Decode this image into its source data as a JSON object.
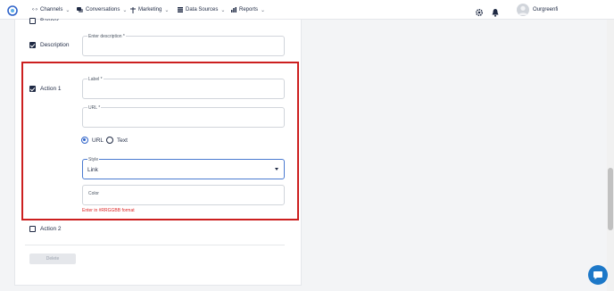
{
  "nav": {
    "items": [
      {
        "label": "Channels"
      },
      {
        "label": "Conversations"
      },
      {
        "label": "Marketing"
      },
      {
        "label": "Data Sources"
      },
      {
        "label": "Reports"
      }
    ],
    "user_name": "Ourgreenfi"
  },
  "form": {
    "banner_label": "Banner",
    "description": {
      "checkbox_label": "Description",
      "field_label": "Enter description *",
      "value": ""
    },
    "action1": {
      "checkbox_label": "Action 1",
      "label_field": {
        "label": "Label *",
        "value": ""
      },
      "url_field": {
        "label": "URL *",
        "value": ""
      },
      "type_options": [
        "URL",
        "Text"
      ],
      "selected_type": "URL",
      "style_field": {
        "label": "Style",
        "value": "Link"
      },
      "color_field": {
        "label": "Color",
        "value": ""
      },
      "color_error": "Enter in #RRGGBB format"
    },
    "action2": {
      "checkbox_label": "Action 2"
    },
    "delete_label": "Delete"
  },
  "colors": {
    "highlight": "#cc1f1f",
    "accent": "#2f63c9",
    "error": "#dc2626",
    "chat": "#1d78c8"
  }
}
